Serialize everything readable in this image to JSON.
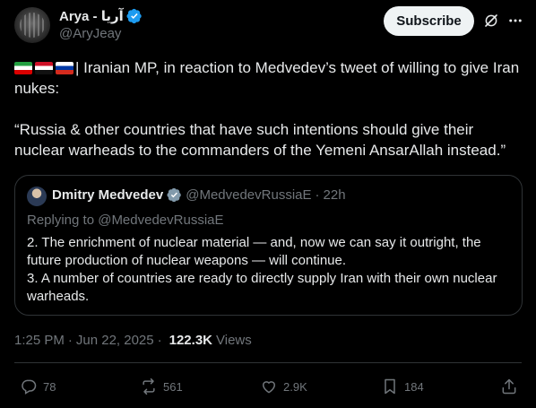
{
  "author": {
    "display_name": "Arya - آریا",
    "handle": "@AryJeay"
  },
  "header": {
    "subscribe_label": "Subscribe",
    "icons": [
      "grok-icon",
      "more-icon"
    ]
  },
  "tweet": {
    "line1": "| Iranian MP, in reaction to Medvedev’s tweet of willing to give Iran nukes:",
    "line2": "“Russia & other countries that have such intentions should give their nuclear warheads to the commanders of the Yemeni AnsarAllah instead.”",
    "flags": [
      "Iran",
      "Yemen",
      "Russia"
    ]
  },
  "quote": {
    "name": "Dmitry Medvedev",
    "handle": "@MedvedevRussiaE",
    "separator": "·",
    "time": "22h",
    "replying_to": "Replying to @MedvedevRussiaE",
    "body_line1": "2. The enrichment of nuclear material — and, now we can say it outright, the future production of nuclear weapons — will continue.",
    "body_line2": "3. A number of countries are ready to directly supply Iran with their own nuclear warheads."
  },
  "meta": {
    "time": "1:25 PM",
    "separator": "·",
    "date": "Jun 22, 2025",
    "views_count": "122.3K",
    "views_label": "Views"
  },
  "actions": {
    "replies": "78",
    "reposts": "561",
    "likes": "2.9K",
    "bookmarks": "184"
  },
  "colors": {
    "background": "#000000",
    "text": "#e7e9ea",
    "muted": "#71767b",
    "verified": "#1d9bf0",
    "border": "#2f3336"
  }
}
